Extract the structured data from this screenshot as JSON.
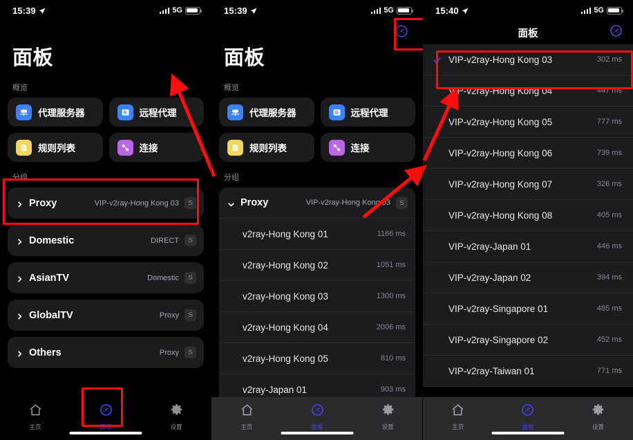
{
  "panel1": {
    "status": {
      "time": "15:39",
      "network": "5G",
      "location_icon": "location-arrow-icon"
    },
    "title": "面板",
    "overview_label": "概览",
    "overview": [
      {
        "label": "代理服务器",
        "icon": "proxy-server-icon",
        "color": "#3b82f6"
      },
      {
        "label": "远程代理",
        "icon": "remote-proxy-icon",
        "color": "#3b82f6"
      },
      {
        "label": "规则列表",
        "icon": "rules-document-icon",
        "color": "#f5d65a"
      },
      {
        "label": "连接",
        "icon": "connections-link-icon",
        "color": "#b967e8"
      }
    ],
    "groups_label": "分组",
    "groups": [
      {
        "name": "Proxy",
        "value": "VIP-v2ray-Hong Kong 03",
        "badge": "S"
      },
      {
        "name": "Domestic",
        "value": "DIRECT",
        "badge": "S"
      },
      {
        "name": "AsianTV",
        "value": "Domestic",
        "badge": "S"
      },
      {
        "name": "GlobalTV",
        "value": "Proxy",
        "badge": "S"
      },
      {
        "name": "Others",
        "value": "Proxy",
        "badge": "S"
      }
    ],
    "tabs": [
      {
        "label": "主页",
        "icon": "home-icon",
        "active": false
      },
      {
        "label": "面板",
        "icon": "speedometer-icon",
        "active": true
      },
      {
        "label": "设置",
        "icon": "gear-icon",
        "active": false
      }
    ]
  },
  "panel2": {
    "status": {
      "time": "15:39",
      "network": "5G",
      "location_icon": "location-arrow-icon"
    },
    "title": "面板",
    "speed_test_button": "speedometer-icon",
    "overview_label": "概览",
    "overview": [
      {
        "label": "代理服务器",
        "icon": "proxy-server-icon",
        "color": "#3b82f6"
      },
      {
        "label": "远程代理",
        "icon": "remote-proxy-icon",
        "color": "#3b82f6"
      },
      {
        "label": "规则列表",
        "icon": "rules-document-icon",
        "color": "#f5d65a"
      },
      {
        "label": "连接",
        "icon": "connections-link-icon",
        "color": "#b967e8"
      }
    ],
    "groups_label": "分组",
    "expanded_group": {
      "name": "Proxy",
      "value": "VIP-v2ray-Hong Kong 03",
      "badge": "S"
    },
    "nodes": [
      {
        "name": "v2ray-Hong Kong 01",
        "latency": "1166 ms"
      },
      {
        "name": "v2ray-Hong Kong 02",
        "latency": "1051 ms"
      },
      {
        "name": "v2ray-Hong Kong 03",
        "latency": "1300 ms"
      },
      {
        "name": "v2ray-Hong Kong 04",
        "latency": "2006 ms"
      },
      {
        "name": "v2ray-Hong Kong 05",
        "latency": "810 ms"
      },
      {
        "name": "v2ray-Japan 01",
        "latency": "903 ms"
      }
    ],
    "tabs": [
      {
        "label": "主页",
        "icon": "home-icon",
        "active": false
      },
      {
        "label": "面板",
        "icon": "speedometer-icon",
        "active": true
      },
      {
        "label": "设置",
        "icon": "gear-icon",
        "active": false
      }
    ]
  },
  "panel3": {
    "status": {
      "time": "15:40",
      "network": "5G",
      "location_icon": "location-arrow-icon"
    },
    "nav_title": "面板",
    "speed_test_button": "speedometer-icon",
    "proxies": [
      {
        "name": "VIP-v2ray-Hong Kong 03",
        "latency": "302 ms",
        "selected": true
      },
      {
        "name": "VIP-v2ray-Hong Kong 04",
        "latency": "447 ms",
        "selected": false
      },
      {
        "name": "VIP-v2ray-Hong Kong 05",
        "latency": "777 ms",
        "selected": false
      },
      {
        "name": "VIP-v2ray-Hong Kong 06",
        "latency": "739 ms",
        "selected": false
      },
      {
        "name": "VIP-v2ray-Hong Kong 07",
        "latency": "326 ms",
        "selected": false
      },
      {
        "name": "VIP-v2ray-Hong Kong 08",
        "latency": "405 ms",
        "selected": false
      },
      {
        "name": "VIP-v2ray-Japan 01",
        "latency": "446 ms",
        "selected": false
      },
      {
        "name": "VIP-v2ray-Japan 02",
        "latency": "394 ms",
        "selected": false
      },
      {
        "name": "VIP-v2ray-Singapore 01",
        "latency": "485 ms",
        "selected": false
      },
      {
        "name": "VIP-v2ray-Singapore 02",
        "latency": "452 ms",
        "selected": false
      },
      {
        "name": "VIP-v2ray-Taiwan 01",
        "latency": "771 ms",
        "selected": false
      }
    ],
    "tabs": [
      {
        "label": "主页",
        "icon": "home-icon",
        "active": false
      },
      {
        "label": "面板",
        "icon": "speedometer-icon",
        "active": true
      },
      {
        "label": "设置",
        "icon": "gear-icon",
        "active": false
      }
    ]
  },
  "annotations": {
    "accent_red": "#ff0d0d",
    "accent_blue": "#4b43e8",
    "highlights": [
      "panel1-proxy-group-box",
      "panel1-panel-tab-box",
      "panel2-speedtest-button-box",
      "panel3-selected-proxy-box"
    ]
  }
}
